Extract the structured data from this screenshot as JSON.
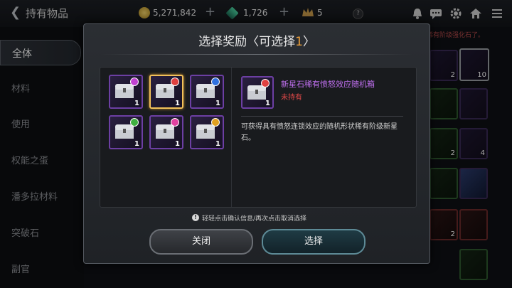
{
  "header": {
    "title": "持有物品",
    "currencies": [
      {
        "icon": "gold-coin-icon",
        "value": "5,271,842"
      },
      {
        "icon": "green-crystal-icon",
        "value": "1,726"
      },
      {
        "icon": "crown-icon",
        "value": "5"
      }
    ]
  },
  "sidebar": {
    "items": [
      "全体",
      "材料",
      "使用",
      "权能之蛋",
      "潘多拉材料",
      "突破石",
      "副官"
    ]
  },
  "background": {
    "hint": "稀有阶级强化石了。",
    "slot_counts": [
      "2",
      "10",
      "2",
      "4",
      "2"
    ]
  },
  "dialog": {
    "title_prefix": "选择奖励〈可选择",
    "title_count": "1",
    "title_suffix": "〉",
    "items": [
      {
        "qty": "1",
        "gem_color": "#c040d0"
      },
      {
        "qty": "1",
        "gem_color": "#e04040"
      },
      {
        "qty": "1",
        "gem_color": "#3070e0"
      },
      {
        "qty": "1",
        "gem_color": "#40b040"
      },
      {
        "qty": "1",
        "gem_color": "#e040a0"
      },
      {
        "qty": "1",
        "gem_color": "#e0a020"
      }
    ],
    "selected_index": 1,
    "detail": {
      "qty": "1",
      "name": "新星石稀有愤怒效应随机箱",
      "status": "未持有",
      "description": "可获得具有愤怒连锁效应的随机形状稀有阶级新星石。"
    },
    "hint": "轻轻点击确认信息/再次点击取消选择",
    "close_label": "关闭",
    "select_label": "选择"
  },
  "colors": {
    "accent_orange": "#f0a23a",
    "rare_purple": "#c070f0",
    "status_red": "#e04848",
    "selected_gold": "#f2c15a"
  }
}
